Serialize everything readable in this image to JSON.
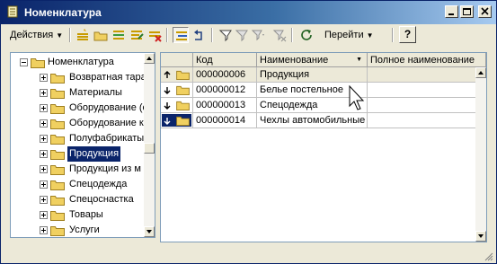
{
  "window": {
    "title": "Номенклатура",
    "colors": {
      "titlebar_start": "#0a246a",
      "titlebar_end": "#a6caf0",
      "face": "#ece9d8",
      "selection": "#0a246a"
    }
  },
  "toolbar": {
    "actions_label": "Действия",
    "goto_label": "Перейти",
    "help_label": "?"
  },
  "tree": {
    "root_label": "Номенклатура",
    "items": [
      {
        "label": "Возвратная тара"
      },
      {
        "label": "Материалы"
      },
      {
        "label": "Оборудование (о"
      },
      {
        "label": "Оборудование к"
      },
      {
        "label": "Полуфабрикаты"
      },
      {
        "label": "Продукция",
        "selected": true
      },
      {
        "label": "Продукция из м"
      },
      {
        "label": "Спецодежда"
      },
      {
        "label": "Спецоснастка"
      },
      {
        "label": "Товары"
      },
      {
        "label": "Услуги"
      }
    ]
  },
  "grid": {
    "columns": [
      "Код",
      "Наименование",
      "Полное наименование"
    ],
    "rows": [
      {
        "code": "000000006",
        "name": "Продукция",
        "full_name": "",
        "marker": "up"
      },
      {
        "code": "000000012",
        "name": "Белье постельное",
        "full_name": "",
        "marker": "down"
      },
      {
        "code": "000000013",
        "name": "Спецодежда",
        "full_name": "",
        "marker": "down"
      },
      {
        "code": "000000014",
        "name": "Чехлы автомобильные",
        "full_name": "",
        "marker": "down",
        "current": true
      }
    ]
  }
}
